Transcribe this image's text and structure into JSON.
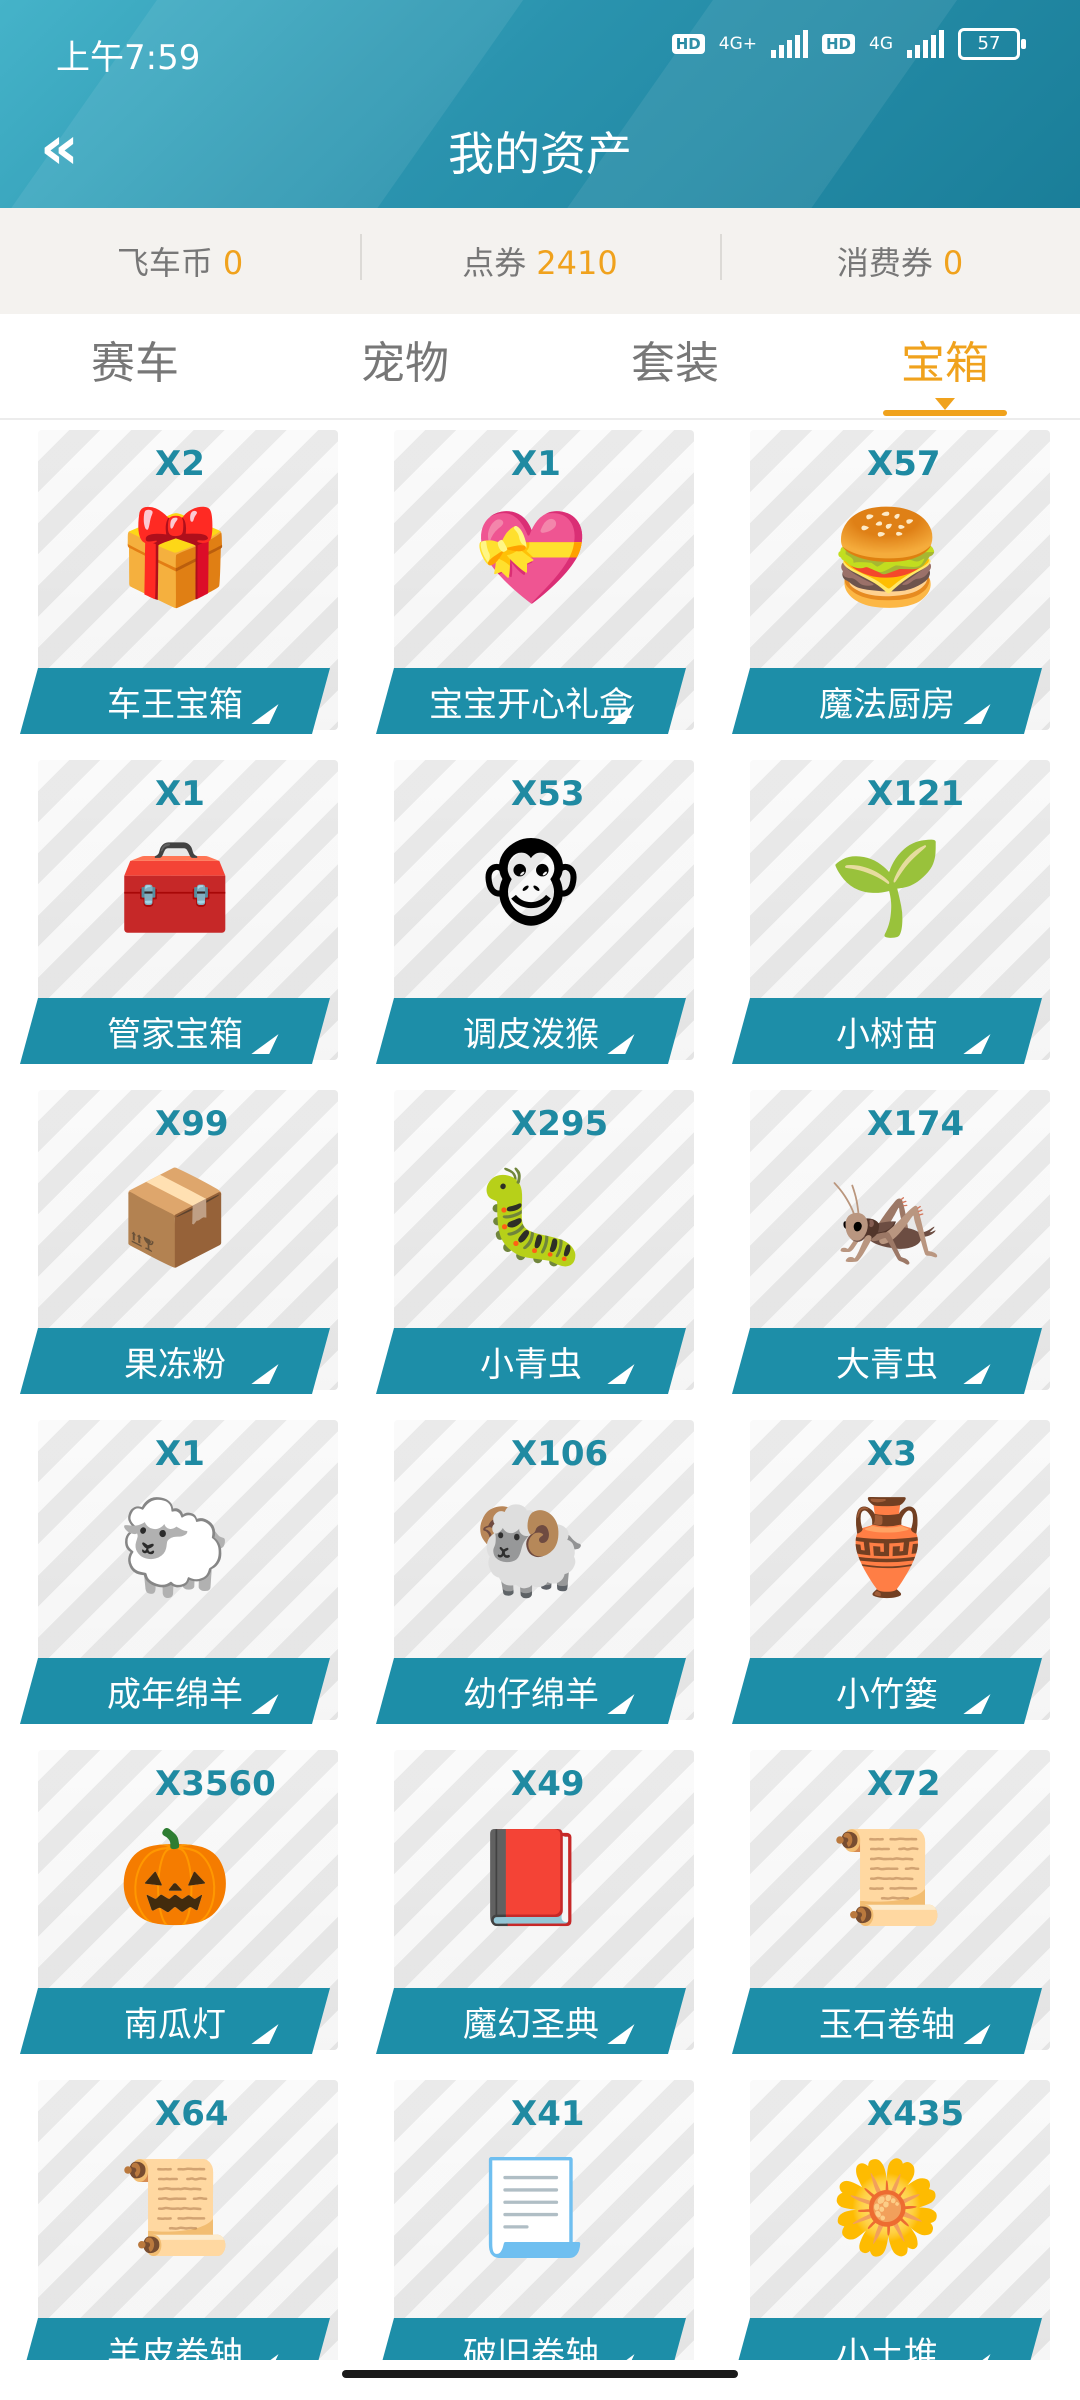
{
  "status": {
    "time": "上午7:59",
    "hd1": "HD",
    "net1": "4G+",
    "hd2": "HD",
    "net2": "4G",
    "battery": "57"
  },
  "header": {
    "title": "我的资产",
    "back_icon": "double-chevron-left-icon"
  },
  "currency": [
    {
      "label": "飞车币",
      "value": "0"
    },
    {
      "label": "点券",
      "value": "2410"
    },
    {
      "label": "消费券",
      "value": "0"
    }
  ],
  "tabs": [
    {
      "label": "赛车",
      "active": false
    },
    {
      "label": "宠物",
      "active": false
    },
    {
      "label": "套装",
      "active": false
    },
    {
      "label": "宝箱",
      "active": true
    }
  ],
  "colors": {
    "accent": "#f0a21d",
    "banner": "#1d8ea8",
    "header": "#2a93ae"
  },
  "items": [
    {
      "qty": "X2",
      "name": "车王宝箱",
      "icon": "🎁"
    },
    {
      "qty": "X1",
      "name": "宝宝开心礼盒",
      "icon": "💝"
    },
    {
      "qty": "X57",
      "name": "魔法厨房",
      "icon": "🍔"
    },
    {
      "qty": "X1",
      "name": "管家宝箱",
      "icon": "🧰"
    },
    {
      "qty": "X53",
      "name": "调皮泼猴",
      "icon": "🐵"
    },
    {
      "qty": "X121",
      "name": "小树苗",
      "icon": "🌱"
    },
    {
      "qty": "X99",
      "name": "果冻粉",
      "icon": "📦"
    },
    {
      "qty": "X295",
      "name": "小青虫",
      "icon": "🐛"
    },
    {
      "qty": "X174",
      "name": "大青虫",
      "icon": "🦗"
    },
    {
      "qty": "X1",
      "name": "成年绵羊",
      "icon": "🐑"
    },
    {
      "qty": "X106",
      "name": "幼仔绵羊",
      "icon": "🐏"
    },
    {
      "qty": "X3",
      "name": "小竹篓",
      "icon": "🏺"
    },
    {
      "qty": "X3560",
      "name": "南瓜灯",
      "icon": "🎃"
    },
    {
      "qty": "X49",
      "name": "魔幻圣典",
      "icon": "📕"
    },
    {
      "qty": "X72",
      "name": "玉石卷轴",
      "icon": "📜"
    },
    {
      "qty": "X64",
      "name": "羊皮卷轴",
      "icon": "📜"
    },
    {
      "qty": "X41",
      "name": "破旧卷轴",
      "icon": "📃"
    },
    {
      "qty": "X435",
      "name": "小土堆",
      "icon": "🌼"
    }
  ]
}
